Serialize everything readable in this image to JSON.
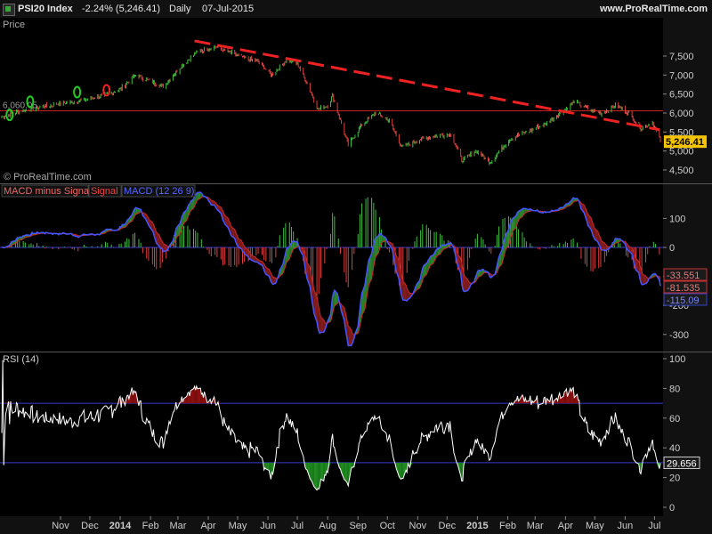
{
  "header": {
    "symbol": "PSI20 Index",
    "change": "-2.24% (5,246.41)",
    "period": "Daily",
    "date": "07-Jul-2015",
    "site": "www.ProRealTime.com",
    "icon": "chart-app-icon"
  },
  "chart_data": [
    {
      "type": "candlestick",
      "title": "Price",
      "watermark": "© ProRealTime.com",
      "y_ticks": [
        4500,
        5000,
        5500,
        6000,
        6500,
        7000,
        7500
      ],
      "y_tick_labels": [
        "4,500",
        "5,000",
        "5,500",
        "6,000",
        "6,500",
        "7,000",
        "7,500"
      ],
      "ylim": [
        4300,
        7900
      ],
      "last_value": 5246.41,
      "last_label": "5,246.41",
      "horizontal_line": {
        "value": 6060,
        "label": "6,060.05",
        "color": "#c82020"
      },
      "trendline": {
        "from": [
          "2014-03-18",
          7900
        ],
        "to": [
          "2015-07-06",
          5560
        ],
        "color": "#ee2222",
        "style": "dashed"
      },
      "markers": [
        {
          "date": "2013-09-10",
          "value": 5950,
          "color": "#22cc22"
        },
        {
          "date": "2013-10-01",
          "value": 6300,
          "color": "#22cc22"
        },
        {
          "date": "2013-11-18",
          "value": 6550,
          "color": "#22cc22"
        },
        {
          "date": "2013-12-18",
          "value": 6600,
          "color": "#ee2222"
        }
      ],
      "close_path": [
        [
          "2013-09-02",
          5900
        ],
        [
          "2013-09-20",
          6050
        ],
        [
          "2013-10-10",
          6150
        ],
        [
          "2013-10-31",
          6250
        ],
        [
          "2013-11-15",
          6300
        ],
        [
          "2013-12-02",
          6380
        ],
        [
          "2013-12-20",
          6500
        ],
        [
          "2014-01-02",
          6650
        ],
        [
          "2014-01-17",
          7000
        ],
        [
          "2014-02-04",
          6800
        ],
        [
          "2014-02-14",
          6700
        ],
        [
          "2014-03-03",
          7200
        ],
        [
          "2014-03-20",
          7600
        ],
        [
          "2014-04-07",
          7750
        ],
        [
          "2014-04-22",
          7600
        ],
        [
          "2014-05-07",
          7450
        ],
        [
          "2014-05-22",
          7350
        ],
        [
          "2014-06-05",
          7000
        ],
        [
          "2014-06-20",
          7400
        ],
        [
          "2014-07-01",
          7300
        ],
        [
          "2014-07-11",
          6800
        ],
        [
          "2014-07-22",
          6100
        ],
        [
          "2014-08-01",
          6200
        ],
        [
          "2014-08-06",
          6450
        ],
        [
          "2014-08-14",
          5800
        ],
        [
          "2014-08-22",
          5150
        ],
        [
          "2014-09-05",
          5700
        ],
        [
          "2014-09-19",
          6000
        ],
        [
          "2014-10-03",
          5800
        ],
        [
          "2014-10-16",
          5100
        ],
        [
          "2014-11-03",
          5300
        ],
        [
          "2014-11-20",
          5400
        ],
        [
          "2014-12-05",
          5450
        ],
        [
          "2014-12-16",
          4750
        ],
        [
          "2014-12-31",
          5000
        ],
        [
          "2015-01-14",
          4700
        ],
        [
          "2015-02-02",
          5300
        ],
        [
          "2015-02-20",
          5500
        ],
        [
          "2015-03-10",
          5700
        ],
        [
          "2015-03-27",
          6000
        ],
        [
          "2015-04-10",
          6300
        ],
        [
          "2015-04-24",
          6100
        ],
        [
          "2015-05-08",
          6000
        ],
        [
          "2015-05-22",
          6200
        ],
        [
          "2015-06-05",
          6000
        ],
        [
          "2015-06-17",
          5600
        ],
        [
          "2015-06-29",
          5750
        ],
        [
          "2015-07-07",
          5246
        ]
      ]
    },
    {
      "type": "histogram+line",
      "title_parts": [
        {
          "text": "MACD minus Signal",
          "color": "#ee6666"
        },
        {
          "text": "Signal",
          "color": "#ee4444"
        },
        {
          "text": "MACD (12 26 9)",
          "color": "#5566ff"
        }
      ],
      "y_ticks": [
        100,
        0,
        -100,
        -200,
        -300
      ],
      "ylim": [
        -330,
        180
      ],
      "last_values": [
        {
          "label": "-33.551",
          "color": "#c83030"
        },
        {
          "label": "-81.535",
          "color": "#c83030"
        },
        {
          "label": "-115.09",
          "color": "#3344cc"
        }
      ]
    },
    {
      "type": "line",
      "title": "RSI (14)",
      "y_ticks": [
        0,
        20,
        40,
        60,
        80,
        100
      ],
      "ylim": [
        0,
        100
      ],
      "levels": [
        30,
        70
      ],
      "level_color": "#3a3ad0",
      "last_label": "29.656"
    }
  ],
  "x_axis": {
    "labels": [
      {
        "text": "Nov",
        "date": "2013-11-01"
      },
      {
        "text": "Dec",
        "date": "2013-12-01"
      },
      {
        "text": "2014",
        "date": "2014-01-01",
        "bold": true
      },
      {
        "text": "Feb",
        "date": "2014-02-01"
      },
      {
        "text": "Mar",
        "date": "2014-03-01"
      },
      {
        "text": "Apr",
        "date": "2014-04-01"
      },
      {
        "text": "May",
        "date": "2014-05-01"
      },
      {
        "text": "Jun",
        "date": "2014-06-01"
      },
      {
        "text": "Jul",
        "date": "2014-07-01"
      },
      {
        "text": "Aug",
        "date": "2014-08-01"
      },
      {
        "text": "Sep",
        "date": "2014-09-01"
      },
      {
        "text": "Oct",
        "date": "2014-10-01"
      },
      {
        "text": "Nov",
        "date": "2014-11-01"
      },
      {
        "text": "Dec",
        "date": "2014-12-01"
      },
      {
        "text": "2015",
        "date": "2015-01-01",
        "bold": true
      },
      {
        "text": "Feb",
        "date": "2015-02-01"
      },
      {
        "text": "Mar",
        "date": "2015-03-01"
      },
      {
        "text": "Apr",
        "date": "2015-04-01"
      },
      {
        "text": "May",
        "date": "2015-05-01"
      },
      {
        "text": "Jun",
        "date": "2015-06-01"
      },
      {
        "text": "Jul",
        "date": "2015-07-01"
      }
    ]
  },
  "colors": {
    "up": "#3ec03e",
    "down": "#e04040",
    "macd_pos": "#3ec03e",
    "macd_neg": "#e04040",
    "signal": "#d02828",
    "macd": "#4455ff",
    "rsi": "#ffffff",
    "rsi_hi_fill": "#8a0f0f",
    "rsi_lo_fill": "#1f8a1f",
    "axis_text": "#cccccc",
    "panel_bg": "#000000",
    "axis_bg": "#111111"
  }
}
